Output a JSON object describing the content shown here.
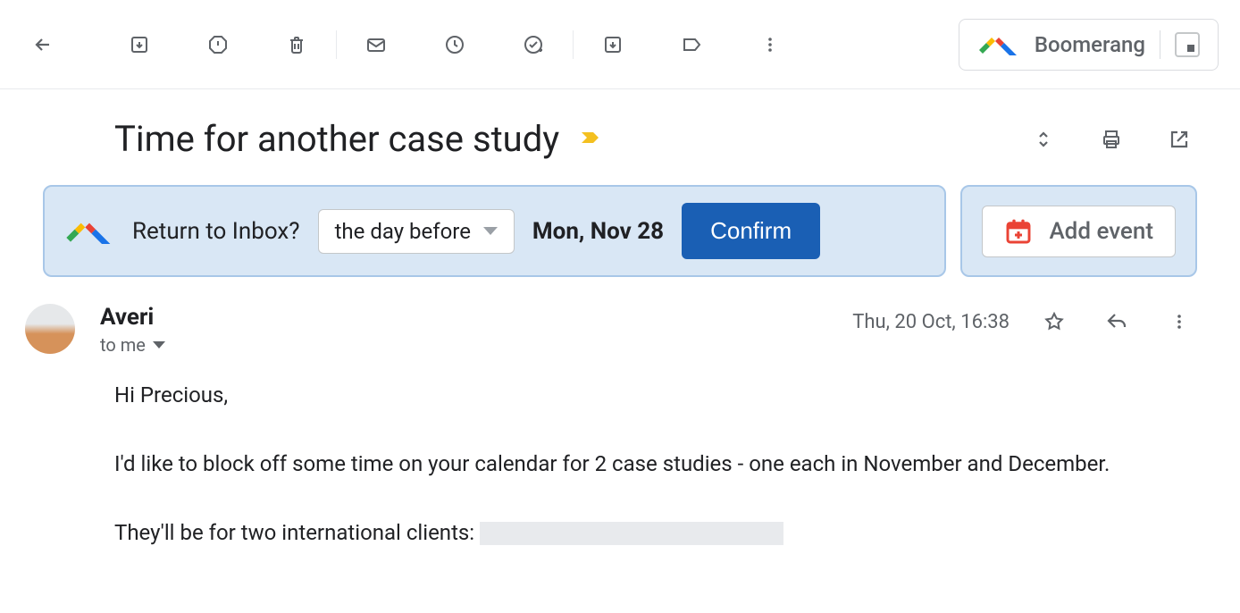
{
  "toolbar": {
    "boomerang_label": "Boomerang"
  },
  "subject": "Time for another case study",
  "banner": {
    "return_label": "Return to Inbox?",
    "dropdown_value": "the day before",
    "date": "Mon, Nov 28",
    "confirm_label": "Confirm",
    "add_event_label": "Add event"
  },
  "message": {
    "sender_name": "Averi",
    "to_label": "to me",
    "timestamp": "Thu, 20 Oct, 16:38",
    "body": {
      "greeting": "Hi Precious,",
      "line1": "I'd like to block off some time on your calendar for 2 case studies - one each in November and December.",
      "line2_prefix": "They'll be for two international clients: "
    }
  }
}
